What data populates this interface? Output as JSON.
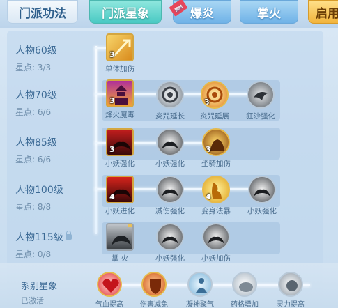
{
  "tabs": [
    {
      "label": "门派功法"
    },
    {
      "label": "门派星象",
      "selected": true
    },
    {
      "label": "爆炎",
      "badge": "限时"
    },
    {
      "label": "掌火"
    },
    {
      "label": "启用"
    }
  ],
  "rows": [
    {
      "level": "人物60级",
      "stars": "星点: 3/3",
      "locked": false
    },
    {
      "level": "人物70级",
      "stars": "星点: 6/6",
      "locked": false
    },
    {
      "level": "人物85级",
      "stars": "星点: 6/6",
      "locked": false
    },
    {
      "level": "人物100级",
      "stars": "星点: 8/8",
      "locked": false
    },
    {
      "level": "人物115级",
      "stars": "星点: 0/8",
      "locked": true
    }
  ],
  "nodes": {
    "r1": [
      {
        "label": "单体加伤",
        "count": "3"
      }
    ],
    "r2": [
      {
        "label": "烽火魔毒",
        "count": "3"
      },
      {
        "label": "炎咒延长",
        "count": ""
      },
      {
        "label": "炎咒延展",
        "count": "3"
      },
      {
        "label": "狂沙强化",
        "count": ""
      }
    ],
    "r3": [
      {
        "label": "小妖强化",
        "count": "3"
      },
      {
        "label": "小妖强化",
        "count": ""
      },
      {
        "label": "坐骑加伤",
        "count": "3"
      }
    ],
    "r4": [
      {
        "label": "小妖进化",
        "count": "4"
      },
      {
        "label": "减伤强化",
        "count": ""
      },
      {
        "label": "变身法暴",
        "count": "4"
      },
      {
        "label": "小妖强化",
        "count": ""
      }
    ],
    "r5": [
      {
        "label": "掌 火",
        "count": ""
      },
      {
        "label": "小妖强化",
        "count": ""
      },
      {
        "label": "小妖加伤",
        "count": ""
      }
    ]
  },
  "series": {
    "title": "系别星象",
    "status": "已激活",
    "items": [
      {
        "label": "气血提高"
      },
      {
        "label": "伤害减免"
      },
      {
        "label": "凝神聚气"
      },
      {
        "label": "药格增加"
      },
      {
        "label": "灵力提高"
      }
    ]
  },
  "colors": {
    "accent_teal": "#49c9c3",
    "tab_blue": "#6fb2e7",
    "gold": "#e6b94a",
    "text": "#3c6a95"
  }
}
